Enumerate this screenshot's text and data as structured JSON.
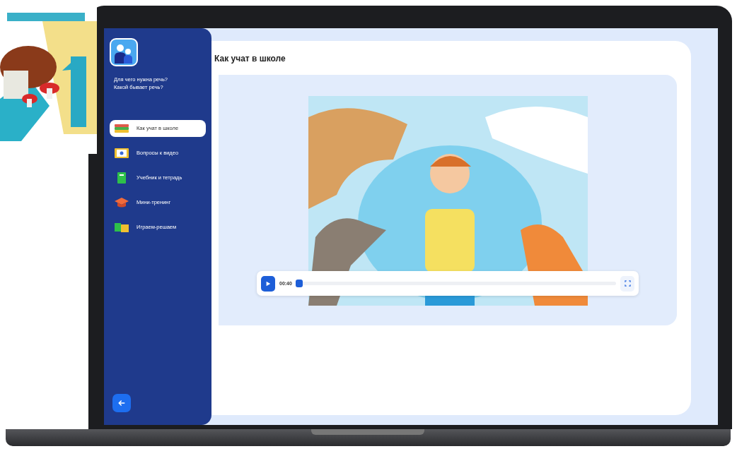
{
  "sidebar": {
    "heading_lines": [
      "Для чего нужна речь?",
      "Какой бывает речь?"
    ],
    "items": [
      {
        "label": "Как учат в школе",
        "kind": "books",
        "selected": true
      },
      {
        "label": "Вопросы к видео",
        "kind": "video",
        "selected": false
      },
      {
        "label": "Учебник и тетрадь",
        "kind": "notebook",
        "selected": false
      },
      {
        "label": "Мини-тренинг",
        "kind": "cap",
        "selected": false
      },
      {
        "label": "Играем-решаем",
        "kind": "puzzle",
        "selected": false
      }
    ]
  },
  "content": {
    "title": "Как учат в школе",
    "video": {
      "kind": "picture",
      "time": "00:40",
      "level": 0.0
    }
  }
}
